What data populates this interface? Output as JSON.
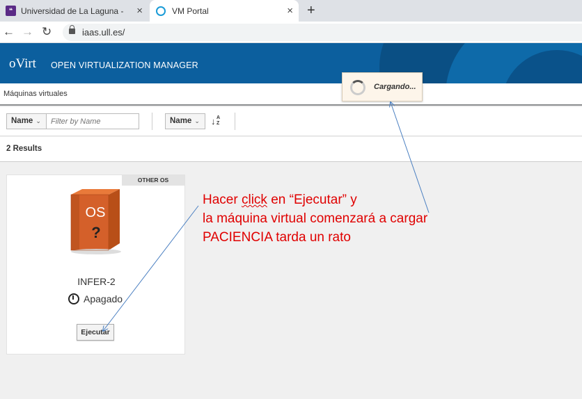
{
  "browser": {
    "tabs": [
      {
        "title": "Universidad de La Laguna - Conte",
        "icon": "ull-favicon"
      },
      {
        "title": "VM Portal",
        "icon": "ovirt-favicon"
      }
    ],
    "new_tab": "+",
    "close": "×",
    "url": "iaas.ull.es/"
  },
  "header": {
    "logo": "oVirt",
    "title": "OPEN VIRTUALIZATION MANAGER"
  },
  "breadcrumb": "Máquinas virtuales",
  "toolbar": {
    "filter_field": "Name",
    "filter_placeholder": "Filter by Name",
    "sort_field": "Name",
    "sort_icon": "A",
    "sort_icon2": "Z"
  },
  "results": "2 Results",
  "vm_card": {
    "badge": "OTHER OS",
    "name": "INFER-2",
    "status": "Apagado",
    "run_button": "Ejecutar",
    "os_label": "OS",
    "os_question": "?"
  },
  "loading": "Cargando...",
  "annotation": {
    "line1_pre": "Hacer ",
    "line1_click": "click",
    "line1_post": " en  “Ejecutar” y",
    "line2": "la máquina virtual comenzará a cargar",
    "line3": "PACIENCIA tarda un rato"
  },
  "colors": {
    "header_blue": "#0c5f9e",
    "annotation_red": "#e00000",
    "arrow_blue": "#4a7fc1"
  }
}
